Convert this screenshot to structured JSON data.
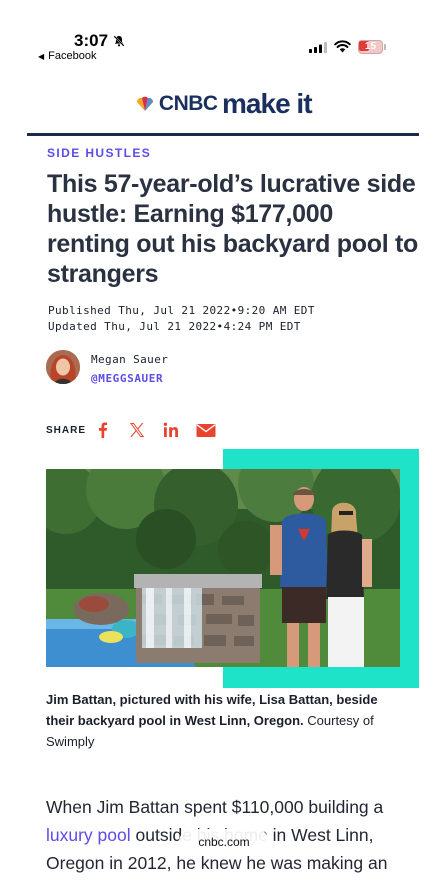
{
  "status_bar": {
    "time": "3:07",
    "back_app": "Facebook",
    "battery": "15",
    "battery_color": "#e33b35"
  },
  "header": {
    "logo_brand": "CNBC",
    "logo_product": "make it",
    "brand_color": "#1b2f5f"
  },
  "article": {
    "category": "SIDE HUSTLES",
    "accent_color": "#5d4ce6",
    "headline": "This 57-year-old’s lucrative side hustle: Earning $177,000 renting out his backyard pool to strangers",
    "published": "Published Thu, Jul 21 2022•9:20 AM EDT",
    "updated": "Updated Thu, Jul 21 2022•4:24 PM EDT",
    "author": {
      "name": "Megan Sauer",
      "handle": "@MEGGSAUER"
    },
    "share": {
      "label": "SHARE",
      "icons": [
        "facebook-icon",
        "x-icon",
        "linkedin-icon",
        "email-icon"
      ]
    },
    "image": {
      "caption_bold": "Jim Battan, pictured with his wife, Lisa Battan, beside their backyard pool in West Linn, Oregon.",
      "credit": "Courtesy of Swimply",
      "frame_color": "#1ee3c8"
    },
    "body": {
      "text_before_link": "When Jim Battan spent $110,000 building a ",
      "link_text": "luxury pool",
      "text_after_link": " outside his home in West Linn, Oregon in 2012, he knew he was making an"
    }
  },
  "browser": {
    "url": "cnbc.com"
  }
}
